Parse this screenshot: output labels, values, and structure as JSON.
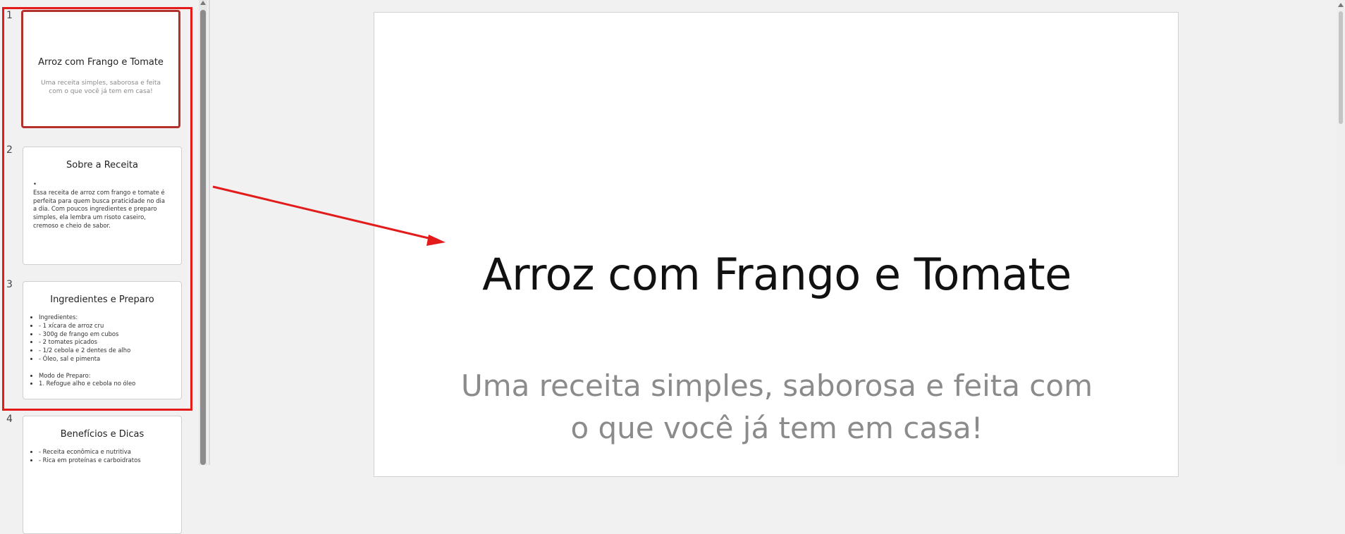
{
  "thumbnails": [
    {
      "number": "1",
      "title": "Arroz com Frango e Tomate",
      "subtitle": "Uma receita simples, saborosa e feita com o que você já tem em casa!"
    },
    {
      "number": "2",
      "title": "Sobre a Receita",
      "paragraph": "Essa receita de arroz com frango e tomate é perfeita para quem busca praticidade no dia a dia. Com poucos ingredientes e preparo simples, ela lembra um risoto caseiro, cremoso e cheio de sabor."
    },
    {
      "number": "3",
      "title": "Ingredientes e Preparo",
      "bullets": [
        "Ingredientes:",
        "- 1 xícara de arroz cru",
        "- 300g de frango em cubos",
        "- 2 tomates picados",
        "- 1/2 cebola e 2 dentes de alho",
        "- Óleo, sal e pimenta",
        "",
        "Modo de Preparo:",
        "1. Refogue alho e cebola no óleo"
      ]
    },
    {
      "number": "4",
      "title": "Benefícios e Dicas",
      "bullets": [
        "- Receita econômica e nutritiva",
        "- Rica em proteínas e carboidratos"
      ]
    }
  ],
  "slide": {
    "title": "Arroz com Frango e Tomate",
    "subtitle": "Uma receita simples, saborosa e feita com o que você já tem em casa!"
  },
  "colors": {
    "selection": "#e31b1b",
    "active_thumb_border": "#b5302a"
  }
}
